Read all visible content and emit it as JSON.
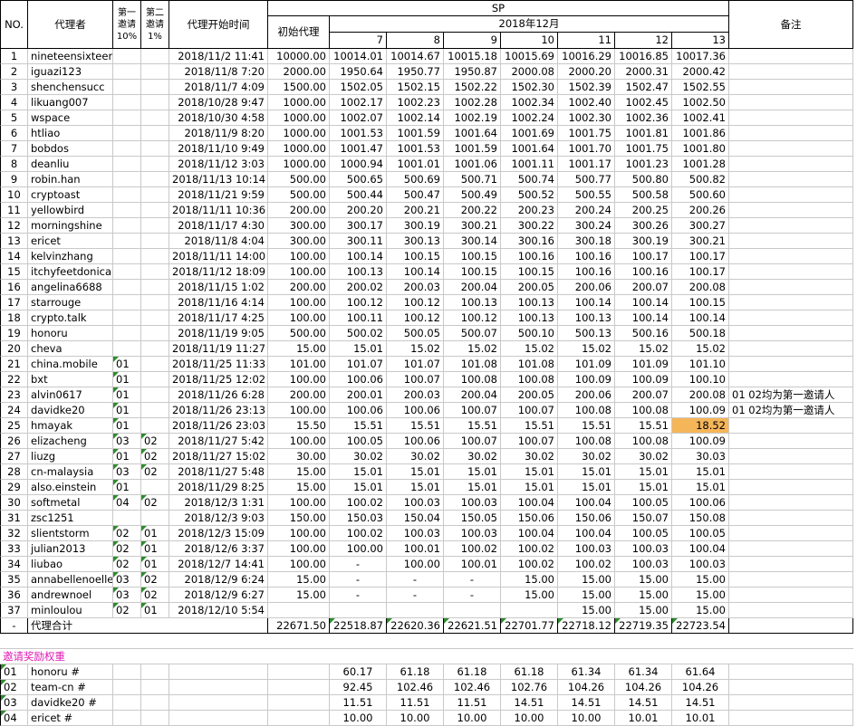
{
  "headers": {
    "no": "NO.",
    "agent": "代理者",
    "inv1": "第一\n邀请\n10%",
    "inv2": "第二\n邀请\n1%",
    "start": "代理开始时间",
    "sp": "SP",
    "initial": "初始代理",
    "month": "2018年12月",
    "days": [
      "7",
      "8",
      "9",
      "10",
      "11",
      "12",
      "13"
    ],
    "note": "备注"
  },
  "rows": [
    {
      "no": "1",
      "name": "nineteensixteen",
      "inv1": "",
      "inv2": "",
      "start": "2018/11/2 11:41",
      "init": "10000.00",
      "d": [
        "10014.01",
        "10014.67",
        "10015.18",
        "10015.69",
        "10016.29",
        "10016.85",
        "10017.36"
      ],
      "note": ""
    },
    {
      "no": "2",
      "name": "iguazi123",
      "inv1": "",
      "inv2": "",
      "start": "2018/11/8 7:20",
      "init": "2000.00",
      "d": [
        "1950.64",
        "1950.77",
        "1950.87",
        "2000.08",
        "2000.20",
        "2000.31",
        "2000.42"
      ],
      "note": ""
    },
    {
      "no": "3",
      "name": "shenchensucc",
      "inv1": "",
      "inv2": "",
      "start": "2018/11/7 4:09",
      "init": "1500.00",
      "d": [
        "1502.05",
        "1502.15",
        "1502.22",
        "1502.30",
        "1502.39",
        "1502.47",
        "1502.55"
      ],
      "note": ""
    },
    {
      "no": "4",
      "name": "likuang007",
      "inv1": "",
      "inv2": "",
      "start": "2018/10/28 9:47",
      "init": "1000.00",
      "d": [
        "1002.17",
        "1002.23",
        "1002.28",
        "1002.34",
        "1002.40",
        "1002.45",
        "1002.50"
      ],
      "note": ""
    },
    {
      "no": "5",
      "name": "wspace",
      "inv1": "",
      "inv2": "",
      "start": "2018/10/30 4:58",
      "init": "1000.00",
      "d": [
        "1002.07",
        "1002.14",
        "1002.19",
        "1002.24",
        "1002.30",
        "1002.36",
        "1002.41"
      ],
      "note": ""
    },
    {
      "no": "6",
      "name": "htliao",
      "inv1": "",
      "inv2": "",
      "start": "2018/11/9 8:20",
      "init": "1000.00",
      "d": [
        "1001.53",
        "1001.59",
        "1001.64",
        "1001.69",
        "1001.75",
        "1001.81",
        "1001.86"
      ],
      "note": ""
    },
    {
      "no": "7",
      "name": "bobdos",
      "inv1": "",
      "inv2": "",
      "start": "2018/11/10 9:49",
      "init": "1000.00",
      "d": [
        "1001.47",
        "1001.53",
        "1001.59",
        "1001.64",
        "1001.70",
        "1001.75",
        "1001.80"
      ],
      "note": ""
    },
    {
      "no": "8",
      "name": "deanliu",
      "inv1": "",
      "inv2": "",
      "start": "2018/11/12 3:03",
      "init": "1000.00",
      "d": [
        "1000.94",
        "1001.01",
        "1001.06",
        "1001.11",
        "1001.17",
        "1001.23",
        "1001.28"
      ],
      "note": ""
    },
    {
      "no": "9",
      "name": "robin.han",
      "inv1": "",
      "inv2": "",
      "start": "2018/11/13 10:14",
      "init": "500.00",
      "d": [
        "500.65",
        "500.69",
        "500.71",
        "500.74",
        "500.77",
        "500.80",
        "500.82"
      ],
      "note": ""
    },
    {
      "no": "10",
      "name": "cryptoast",
      "inv1": "",
      "inv2": "",
      "start": "2018/11/21 9:59",
      "init": "500.00",
      "d": [
        "500.44",
        "500.47",
        "500.49",
        "500.52",
        "500.55",
        "500.58",
        "500.60"
      ],
      "note": ""
    },
    {
      "no": "11",
      "name": "yellowbird",
      "inv1": "",
      "inv2": "",
      "start": "2018/11/11 10:36",
      "init": "200.00",
      "d": [
        "200.20",
        "200.21",
        "200.22",
        "200.23",
        "200.24",
        "200.25",
        "200.26"
      ],
      "note": ""
    },
    {
      "no": "12",
      "name": "morningshine",
      "inv1": "",
      "inv2": "",
      "start": "2018/11/17 4:30",
      "init": "300.00",
      "d": [
        "300.17",
        "300.19",
        "300.21",
        "300.22",
        "300.24",
        "300.26",
        "300.27"
      ],
      "note": ""
    },
    {
      "no": "13",
      "name": "ericet",
      "inv1": "",
      "inv2": "",
      "start": "2018/11/8 4:04",
      "init": "300.00",
      "d": [
        "300.11",
        "300.13",
        "300.14",
        "300.16",
        "300.18",
        "300.19",
        "300.21"
      ],
      "note": ""
    },
    {
      "no": "14",
      "name": "kelvinzhang",
      "inv1": "",
      "inv2": "",
      "start": "2018/11/11 14:00",
      "init": "100.00",
      "d": [
        "100.14",
        "100.15",
        "100.15",
        "100.16",
        "100.16",
        "100.17",
        "100.17"
      ],
      "note": ""
    },
    {
      "no": "15",
      "name": "itchyfeetdonica",
      "inv1": "",
      "inv2": "",
      "start": "2018/11/12 18:09",
      "init": "100.00",
      "d": [
        "100.13",
        "100.14",
        "100.15",
        "100.15",
        "100.16",
        "100.16",
        "100.17"
      ],
      "note": ""
    },
    {
      "no": "16",
      "name": "angelina6688",
      "inv1": "",
      "inv2": "",
      "start": "2018/11/15 1:02",
      "init": "200.00",
      "d": [
        "200.02",
        "200.03",
        "200.04",
        "200.05",
        "200.06",
        "200.07",
        "200.08"
      ],
      "note": ""
    },
    {
      "no": "17",
      "name": "starrouge",
      "inv1": "",
      "inv2": "",
      "start": "2018/11/16 4:14",
      "init": "100.00",
      "d": [
        "100.12",
        "100.12",
        "100.13",
        "100.13",
        "100.14",
        "100.14",
        "100.15"
      ],
      "note": ""
    },
    {
      "no": "18",
      "name": "crypto.talk",
      "inv1": "",
      "inv2": "",
      "start": "2018/11/17 4:25",
      "init": "100.00",
      "d": [
        "100.11",
        "100.12",
        "100.12",
        "100.13",
        "100.13",
        "100.14",
        "100.14"
      ],
      "note": ""
    },
    {
      "no": "19",
      "name": "honoru",
      "inv1": "",
      "inv2": "",
      "start": "2018/11/19 9:05",
      "init": "500.00",
      "d": [
        "500.02",
        "500.05",
        "500.07",
        "500.10",
        "500.13",
        "500.16",
        "500.18"
      ],
      "note": ""
    },
    {
      "no": "20",
      "name": "cheva",
      "inv1": "",
      "inv2": "",
      "start": "2018/11/19 11:27",
      "init": "15.00",
      "d": [
        "15.01",
        "15.02",
        "15.02",
        "15.02",
        "15.02",
        "15.02",
        "15.02"
      ],
      "note": ""
    },
    {
      "no": "21",
      "name": "china.mobile",
      "inv1": "01",
      "inv2": "",
      "start": "2018/11/25 11:33",
      "init": "101.00",
      "d": [
        "101.07",
        "101.07",
        "101.08",
        "101.08",
        "101.09",
        "101.09",
        "101.10"
      ],
      "note": ""
    },
    {
      "no": "22",
      "name": "bxt",
      "inv1": "01",
      "inv2": "",
      "start": "2018/11/25 12:02",
      "init": "100.00",
      "d": [
        "100.06",
        "100.07",
        "100.08",
        "100.08",
        "100.09",
        "100.09",
        "100.10"
      ],
      "note": ""
    },
    {
      "no": "23",
      "name": "alvin0617",
      "inv1": "01",
      "inv2": "",
      "start": "2018/11/26 6:28",
      "init": "200.00",
      "d": [
        "200.01",
        "200.03",
        "200.04",
        "200.05",
        "200.06",
        "200.07",
        "200.08"
      ],
      "note": "01 02均为第一邀请人"
    },
    {
      "no": "24",
      "name": "davidke20",
      "inv1": "01",
      "inv2": "",
      "start": "2018/11/26 23:13",
      "init": "100.00",
      "d": [
        "100.06",
        "100.06",
        "100.07",
        "100.07",
        "100.08",
        "100.08",
        "100.09"
      ],
      "note": "01 02均为第一邀请人"
    },
    {
      "no": "25",
      "name": "hmayak",
      "inv1": "01",
      "inv2": "",
      "start": "2018/11/26 23:03",
      "init": "15.50",
      "d": [
        "15.51",
        "15.51",
        "15.51",
        "15.51",
        "15.51",
        "15.51",
        "18.52"
      ],
      "note": "",
      "hl": true
    },
    {
      "no": "26",
      "name": "elizacheng",
      "inv1": "03",
      "inv2": "02",
      "start": "2018/11/27 5:42",
      "init": "100.00",
      "d": [
        "100.05",
        "100.06",
        "100.07",
        "100.07",
        "100.08",
        "100.08",
        "100.09"
      ],
      "note": ""
    },
    {
      "no": "27",
      "name": "liuzg",
      "inv1": "01",
      "inv2": "02",
      "start": "2018/11/27 15:02",
      "init": "30.00",
      "d": [
        "30.02",
        "30.02",
        "30.02",
        "30.02",
        "30.02",
        "30.02",
        "30.03"
      ],
      "note": ""
    },
    {
      "no": "28",
      "name": "cn-malaysia",
      "inv1": "03",
      "inv2": "02",
      "start": "2018/11/27 5:48",
      "init": "15.00",
      "d": [
        "15.01",
        "15.01",
        "15.01",
        "15.01",
        "15.01",
        "15.01",
        "15.01"
      ],
      "note": ""
    },
    {
      "no": "29",
      "name": "also.einstein",
      "inv1": "01",
      "inv2": "",
      "start": "2018/11/29 8:25",
      "init": "15.00",
      "d": [
        "15.01",
        "15.01",
        "15.01",
        "15.01",
        "15.01",
        "15.01",
        "15.01"
      ],
      "note": ""
    },
    {
      "no": "30",
      "name": "softmetal",
      "inv1": "04",
      "inv2": "02",
      "start": "2018/12/3 1:31",
      "init": "100.00",
      "d": [
        "100.02",
        "100.03",
        "100.03",
        "100.04",
        "100.04",
        "100.05",
        "100.06"
      ],
      "note": ""
    },
    {
      "no": "31",
      "name": "zsc1251",
      "inv1": "",
      "inv2": "",
      "start": "2018/12/3 9:03",
      "init": "150.00",
      "d": [
        "150.03",
        "150.04",
        "150.05",
        "150.06",
        "150.06",
        "150.07",
        "150.08"
      ],
      "note": ""
    },
    {
      "no": "32",
      "name": "slientstorm",
      "inv1": "02",
      "inv2": "01",
      "start": "2018/12/3 15:09",
      "init": "100.00",
      "d": [
        "100.02",
        "100.03",
        "100.03",
        "100.04",
        "100.04",
        "100.05",
        "100.05"
      ],
      "note": ""
    },
    {
      "no": "33",
      "name": "julian2013",
      "inv1": "02",
      "inv2": "01",
      "start": "2018/12/6 3:37",
      "init": "100.00",
      "d": [
        "100.00",
        "100.01",
        "100.02",
        "100.02",
        "100.03",
        "100.03",
        "100.04"
      ],
      "note": ""
    },
    {
      "no": "34",
      "name": "liubao",
      "inv1": "02",
      "inv2": "01",
      "start": "2018/12/7 14:41",
      "init": "100.00",
      "d": [
        "-",
        "100.00",
        "100.01",
        "100.02",
        "100.02",
        "100.03",
        "100.03"
      ],
      "note": ""
    },
    {
      "no": "35",
      "name": "annabellenoelle",
      "inv1": "03",
      "inv2": "02",
      "start": "2018/12/9 6:24",
      "init": "15.00",
      "d": [
        "-",
        "-",
        "-",
        "15.00",
        "15.00",
        "15.00",
        "15.00"
      ],
      "note": ""
    },
    {
      "no": "36",
      "name": "andrewnoel",
      "inv1": "03",
      "inv2": "02",
      "start": "2018/12/9 6:27",
      "init": "15.00",
      "d": [
        "-",
        "-",
        "-",
        "15.00",
        "15.00",
        "15.00",
        "15.00"
      ],
      "note": ""
    },
    {
      "no": "37",
      "name": "minloulou",
      "inv1": "02",
      "inv2": "01",
      "start": "2018/12/10 5:54",
      "init": "",
      "d": [
        "",
        "",
        "",
        "",
        "15.00",
        "15.00",
        "15.00"
      ],
      "note": ""
    }
  ],
  "total": {
    "no": "-",
    "label": "代理合计",
    "init": "22671.50",
    "d": [
      "22518.87",
      "22620.36",
      "22621.51",
      "22701.77",
      "22718.12",
      "22719.35",
      "22723.54"
    ]
  },
  "weights_title": "邀请奖励权重",
  "weights": [
    {
      "no": "01",
      "name": "honoru #",
      "d": [
        "60.17",
        "61.18",
        "61.18",
        "61.18",
        "61.34",
        "61.34",
        "61.64"
      ]
    },
    {
      "no": "02",
      "name": "team-cn #",
      "d": [
        "92.45",
        "102.46",
        "102.46",
        "102.76",
        "104.26",
        "104.26",
        "104.26"
      ]
    },
    {
      "no": "03",
      "name": "davidke20 #",
      "d": [
        "11.51",
        "11.51",
        "11.51",
        "14.51",
        "14.51",
        "14.51",
        "14.51"
      ]
    },
    {
      "no": "04",
      "name": "ericet #",
      "d": [
        "10.00",
        "10.00",
        "10.00",
        "10.00",
        "10.00",
        "10.01",
        "10.01"
      ]
    }
  ],
  "colors": {
    "highlight": "#f5b65a",
    "weights_title": "#e01ab4",
    "comment_flag": "#2e8b2e"
  }
}
